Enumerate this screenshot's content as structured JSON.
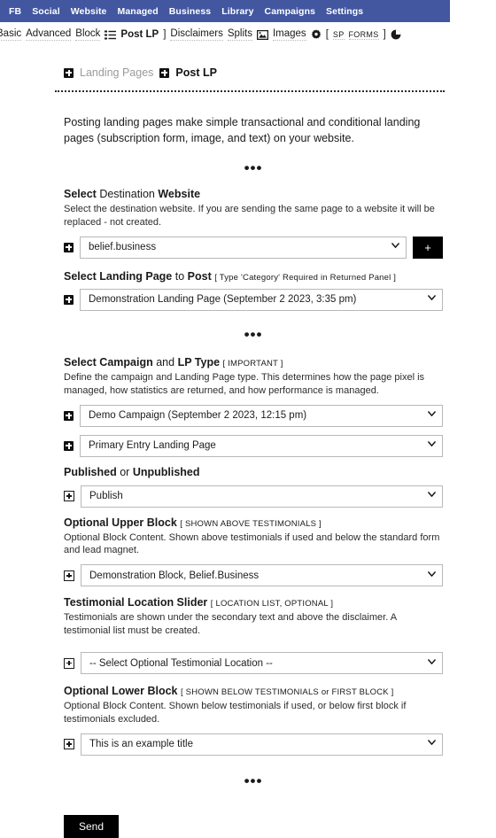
{
  "topnav": {
    "items": [
      {
        "label": "FB"
      },
      {
        "label": "Social"
      },
      {
        "label": "Website"
      },
      {
        "label": "Managed"
      },
      {
        "label": "Business"
      },
      {
        "label": "Library"
      },
      {
        "label": "Campaigns"
      },
      {
        "label": "Settings"
      }
    ]
  },
  "subnav": {
    "basic": "Basic",
    "advanced": "Advanced",
    "block": "Block",
    "list_icon": "list-icon",
    "post_lp": "Post LP",
    "bracket_close": "]",
    "disclaimers": "Disclaimers",
    "splits": "Splits",
    "image_icon": "image-icon",
    "images": "Images",
    "gear_icon": "gear-icon",
    "bracket_open": "[",
    "sp": "SP",
    "forms": "FORMS",
    "bracket_close_2": "]",
    "chart_icon": "pie-chart-icon"
  },
  "breadcrumb": {
    "parent": "Landing Pages",
    "current": "Post LP"
  },
  "intro": "Posting landing pages make simple transactional and conditional landing pages (subscription form, image, and text) on your website.",
  "dots": "•••",
  "sections": {
    "destination": {
      "title_a": "Select",
      "title_b": "Destination",
      "title_c": "Website",
      "desc": "Select the destination website. If you are sending the same page to a website it will be replaced - not created.",
      "value": "belief.business",
      "add_label": "+"
    },
    "landing_page": {
      "title_a": "Select Landing Page",
      "title_b": "to",
      "title_c": "Post",
      "tag": "[ Type 'Category' Required in Returned Panel ]",
      "value": "Demonstration Landing Page (September 2 2023, 3:35 pm)"
    },
    "campaign": {
      "title_a": "Select Campaign",
      "title_b": "and",
      "title_c": "LP Type",
      "tag": "[ IMPORTANT ]",
      "desc": "Define the campaign and Landing Page type. This determines how the page pixel is managed, how statistics are returned, and how performance is managed.",
      "value_campaign": "Demo Campaign (September 2 2023, 12:15 pm)",
      "value_lptype": "Primary Entry Landing Page"
    },
    "published": {
      "title_a": "Published",
      "title_b": "or",
      "title_c": "Unpublished",
      "value": "Publish"
    },
    "upper_block": {
      "title": "Optional Upper Block",
      "tag": "[ SHOWN ABOVE TESTIMONIALS ]",
      "desc": "Optional Block Content. Shown above testimonials if used and below the standard form and lead magnet.",
      "value": "Demonstration Block, Belief.Business"
    },
    "testimonial": {
      "title": "Testimonial Location Slider",
      "tag": "[ LOCATION LIST, OPTIONAL ]",
      "desc": "Testimonials are shown under the secondary text and above the disclaimer. A testimonial list must be created.",
      "value": "-- Select Optional Testimonial Location --"
    },
    "lower_block": {
      "title": "Optional Lower Block",
      "tag": "[ SHOWN BELOW TESTIMONIALS or FIRST BLOCK ]",
      "desc": "Optional Block Content. Shown below testimonials if used, or below first block if testimonials excluded.",
      "value": "This is an example title"
    }
  },
  "footer": {
    "send_label": "Send"
  },
  "colors": {
    "navbar": "#4257a0",
    "button": "#000000",
    "border": "#b8b8b8",
    "muted_text": "#9a9a9a"
  }
}
